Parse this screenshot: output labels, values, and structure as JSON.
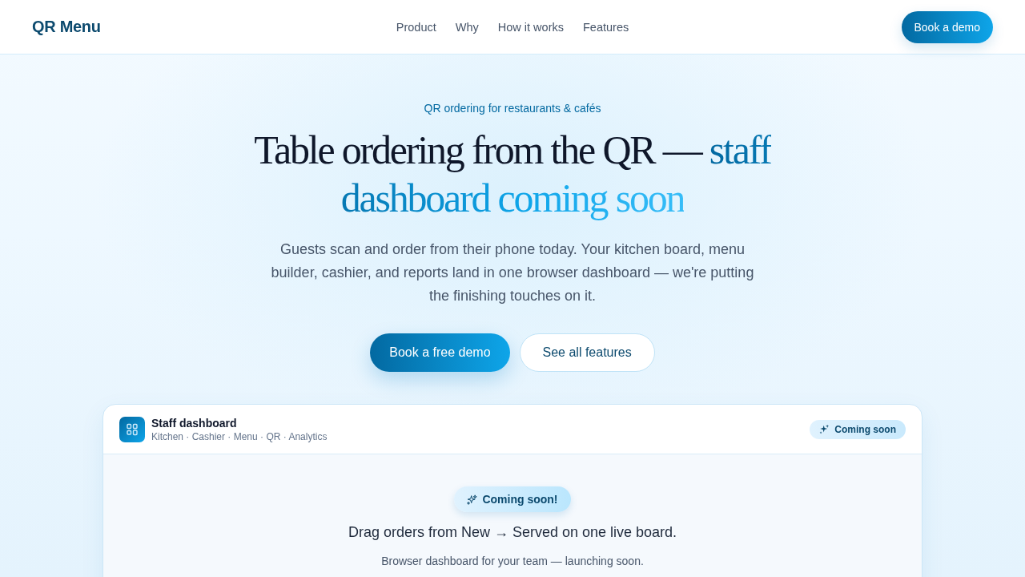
{
  "nav": {
    "logo": "QR Menu",
    "links": [
      "Product",
      "Why",
      "How it works",
      "Features"
    ],
    "cta": "Book a demo"
  },
  "hero": {
    "eyebrow": "QR ordering for restaurants & cafés",
    "headline": {
      "lead": "Table ordering from the QR — ",
      "accent": "staff dashboard coming soon"
    },
    "intro": "Guests scan and order from their phone today. Your kitchen board, menu builder, cashier, and reports land in one browser dashboard — we're putting the finishing touches on it.",
    "buttons": [
      {
        "label": "Book a free demo",
        "kind": "primary"
      },
      {
        "label": "See all features",
        "kind": "secondary"
      }
    ]
  },
  "preview": {
    "title": "Staff dashboard",
    "subtitle": "Kitchen · Cashier · Menu · QR · Analytics",
    "badge": "Coming soon",
    "callout": "Coming soon!",
    "headline": "Drag orders from New → Served on one live board.",
    "note": "Browser dashboard for your team — launching soon."
  }
}
